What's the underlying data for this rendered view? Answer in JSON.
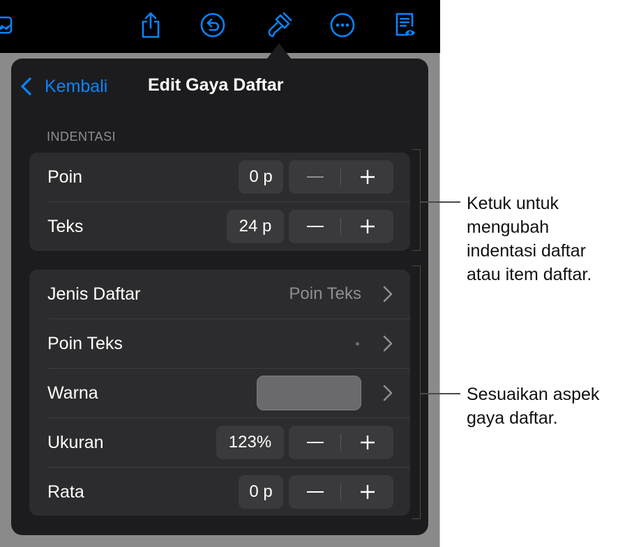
{
  "toolbar": {
    "icons": [
      "media-icon",
      "share-icon",
      "undo-icon",
      "format-brush-icon",
      "more-icon",
      "reader-view-icon"
    ]
  },
  "colors": {
    "accent": "#0a84ff",
    "popover_bg": "#1c1c1e",
    "group_bg": "#2c2c2e",
    "control_bg": "#3a3a3c",
    "secondary_text": "#8e8e93",
    "color_well": "#6a6a6e"
  },
  "popover": {
    "back_label": "Kembali",
    "title": "Edit Gaya Daftar",
    "section_header": "INDENTASI",
    "indent_rows": [
      {
        "label": "Poin",
        "value": "0 p",
        "minus": "−",
        "plus": "+"
      },
      {
        "label": "Teks",
        "value": "24 p",
        "minus": "−",
        "plus": "+"
      }
    ],
    "list_rows": {
      "list_type": {
        "label": "Jenis Daftar",
        "value": "Poin Teks"
      },
      "bullet_text": {
        "label": "Poin Teks",
        "value": "•"
      },
      "color": {
        "label": "Warna"
      },
      "size": {
        "label": "Ukuran",
        "value": "123%",
        "minus": "−",
        "plus": "+"
      },
      "align": {
        "label": "Rata",
        "value": "0 p",
        "minus": "−",
        "plus": "+"
      }
    }
  },
  "callouts": {
    "indent": [
      "Ketuk untuk",
      "mengubah",
      "indentasi daftar",
      "atau item daftar."
    ],
    "style": [
      "Sesuaikan aspek",
      "gaya daftar."
    ]
  }
}
